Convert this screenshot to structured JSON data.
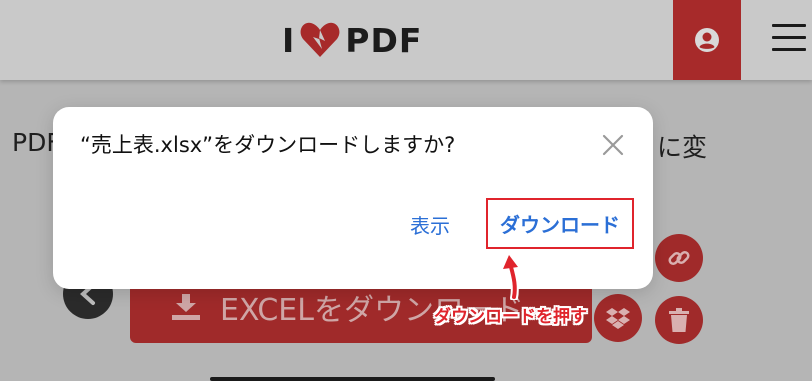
{
  "header": {
    "logo_left": "I",
    "logo_right": "PDF"
  },
  "background": {
    "heading_left": "PDF",
    "heading_right": "に変",
    "excel_button_label": "EXCELをダウンロード"
  },
  "dialog": {
    "title": "“売上表.xlsx”をダウンロードしますか?",
    "show_label": "表示",
    "download_label": "ダウンロード"
  },
  "annotation": {
    "note": "ダウンロードを押す"
  },
  "colors": {
    "brand_red": "#a02a2a",
    "link_blue": "#2b6fd6",
    "annotation_red": "#e0242c"
  }
}
